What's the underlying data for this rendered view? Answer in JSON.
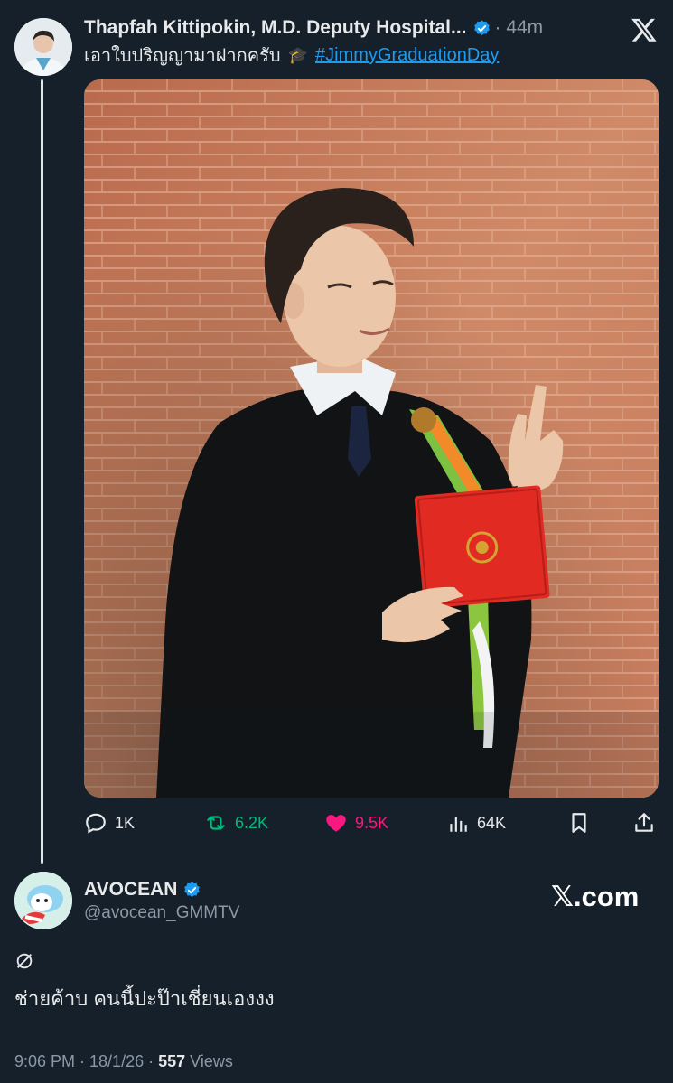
{
  "original_post": {
    "author_name": "Thapfah Kittipokin, M.D. Deputy Hospital...",
    "time": "· 44m",
    "text": "เอาใบปริญญามาฝากครับ",
    "text_emoji": "🎓",
    "hashtag": "#JimmyGraduationDay",
    "verified": true,
    "stats": {
      "replies": "1K",
      "reposts": "6.2K",
      "likes": "9.5K",
      "views": "64K"
    }
  },
  "reply_post": {
    "author_name": "AVOCEAN",
    "handle": "@avocean_GMMTV",
    "verified": true,
    "text": "ช่ายค้าบ คนนี้ปะป๊าเชี่ยนเองงง",
    "timestamp": "9:06 PM · 18/1/26 ·",
    "views_count": "557",
    "views_label": "Views"
  },
  "brand": {
    "xcom": "𝕏.com"
  },
  "colors": {
    "background": "#15202b",
    "accent": "#1d9bf0",
    "repost": "#00ba7c",
    "like": "#f91880",
    "muted": "#8b98a5"
  }
}
